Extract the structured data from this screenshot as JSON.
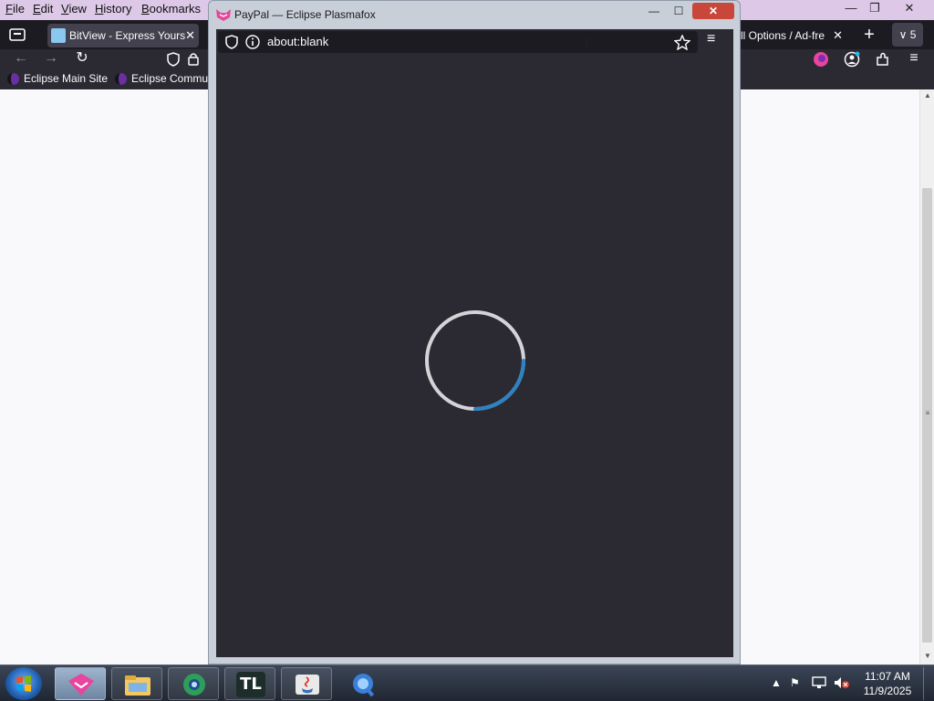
{
  "menubar": {
    "items": [
      {
        "label": "File",
        "key": "F",
        "rest": "ile"
      },
      {
        "label": "Edit",
        "key": "E",
        "rest": "dit"
      },
      {
        "label": "View",
        "key": "V",
        "rest": "iew"
      },
      {
        "label": "History",
        "key": "H",
        "rest": "istory"
      },
      {
        "label": "Bookmarks",
        "key": "B",
        "rest": "ookmarks"
      }
    ]
  },
  "tabs": {
    "left": {
      "title": "BitView - Express Yours",
      "close": "✕"
    },
    "right": {
      "title": "ll Options / Ad-fre",
      "close": "✕"
    },
    "new_tab": "+",
    "tab_count": "5"
  },
  "bookmarks": [
    {
      "label": "Eclipse Main Site"
    },
    {
      "label": "Eclipse Commu"
    }
  ],
  "popup": {
    "title": "PayPal — Eclipse Plasmafox",
    "url": "about:blank",
    "minimize": "—",
    "maximize": "☐",
    "close": "✕"
  },
  "loading": {
    "progress": 0.25,
    "track_color": "#d4d4d8",
    "progress_color": "#2b83c4"
  },
  "taskbar": {
    "clock_time": "11:07 AM",
    "clock_date": "11/9/2025",
    "apps": [
      "plasmafox",
      "file-explorer",
      "chrome-like",
      "tl-app",
      "java",
      "search-app"
    ],
    "tl_label": "TL"
  },
  "colors": {
    "browser_dark": "#2b2a33",
    "tabstrip": "#1c1b22",
    "menubar": "#ddc8e8",
    "accent_pink": "#e8459d"
  }
}
